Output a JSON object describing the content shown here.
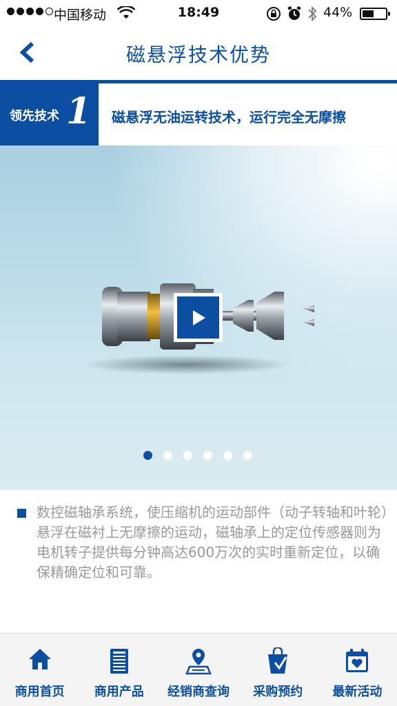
{
  "status_bar": {
    "carrier": "中国移动",
    "time": "18:49",
    "battery": "44%",
    "battery_level": 0.44,
    "icons": [
      "signal-dots-icon",
      "wifi-icon",
      "orientation-lock-icon",
      "alarm-icon",
      "bluetooth-icon",
      "battery-icon"
    ]
  },
  "nav": {
    "title": "磁悬浮技术优势",
    "back_icon": "chevron-left-icon"
  },
  "feature": {
    "tag_label": "领先技术",
    "tag_number": "1",
    "headline": "磁悬浮无油运转技术，运行完全无摩擦"
  },
  "hero": {
    "play_icon": "play-icon",
    "slide_count": 6,
    "active_slide": 0
  },
  "description": {
    "text": "数控磁轴承系统，使压缩机的运动部件（动子转轴和叶轮）悬浮在磁衬上无摩擦的运动，磁轴承上的定位传感器则为电机转子提供每分钟高达600万次的实时重新定位，以确保精确定位和可靠。"
  },
  "tabs": [
    {
      "label": "商用首页",
      "icon": "home-icon"
    },
    {
      "label": "商用产品",
      "icon": "product-icon"
    },
    {
      "label": "经销商查询",
      "icon": "map-pin-icon"
    },
    {
      "label": "采购预约",
      "icon": "bag-icon"
    },
    {
      "label": "最新活动",
      "icon": "calendar-heart-icon"
    }
  ],
  "colors": {
    "brand_blue": "#0b4ea2",
    "text_gray": "#999999"
  }
}
